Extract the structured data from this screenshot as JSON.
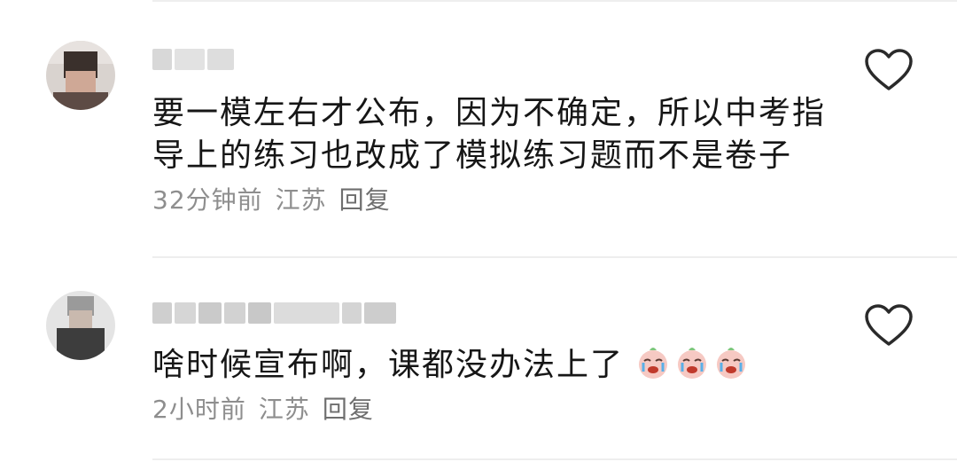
{
  "comments": [
    {
      "text": "要一模左右才公布，因为不确定，所以中考指导上的练习也改成了模拟练习题而不是卷子",
      "time": "32分钟前",
      "location": "江苏",
      "reply_label": "回复",
      "like_icon": "heart-outline-icon"
    },
    {
      "text": "啥时候宣布啊，课都没办法上了",
      "emoji_icon": "crying-face-icon",
      "emoji_count": 3,
      "time": "2小时前",
      "location": "江苏",
      "reply_label": "回复",
      "like_icon": "heart-outline-icon"
    }
  ],
  "colors": {
    "text": "#161616",
    "meta": "#8e8e8e",
    "divider": "#eeeeee"
  }
}
